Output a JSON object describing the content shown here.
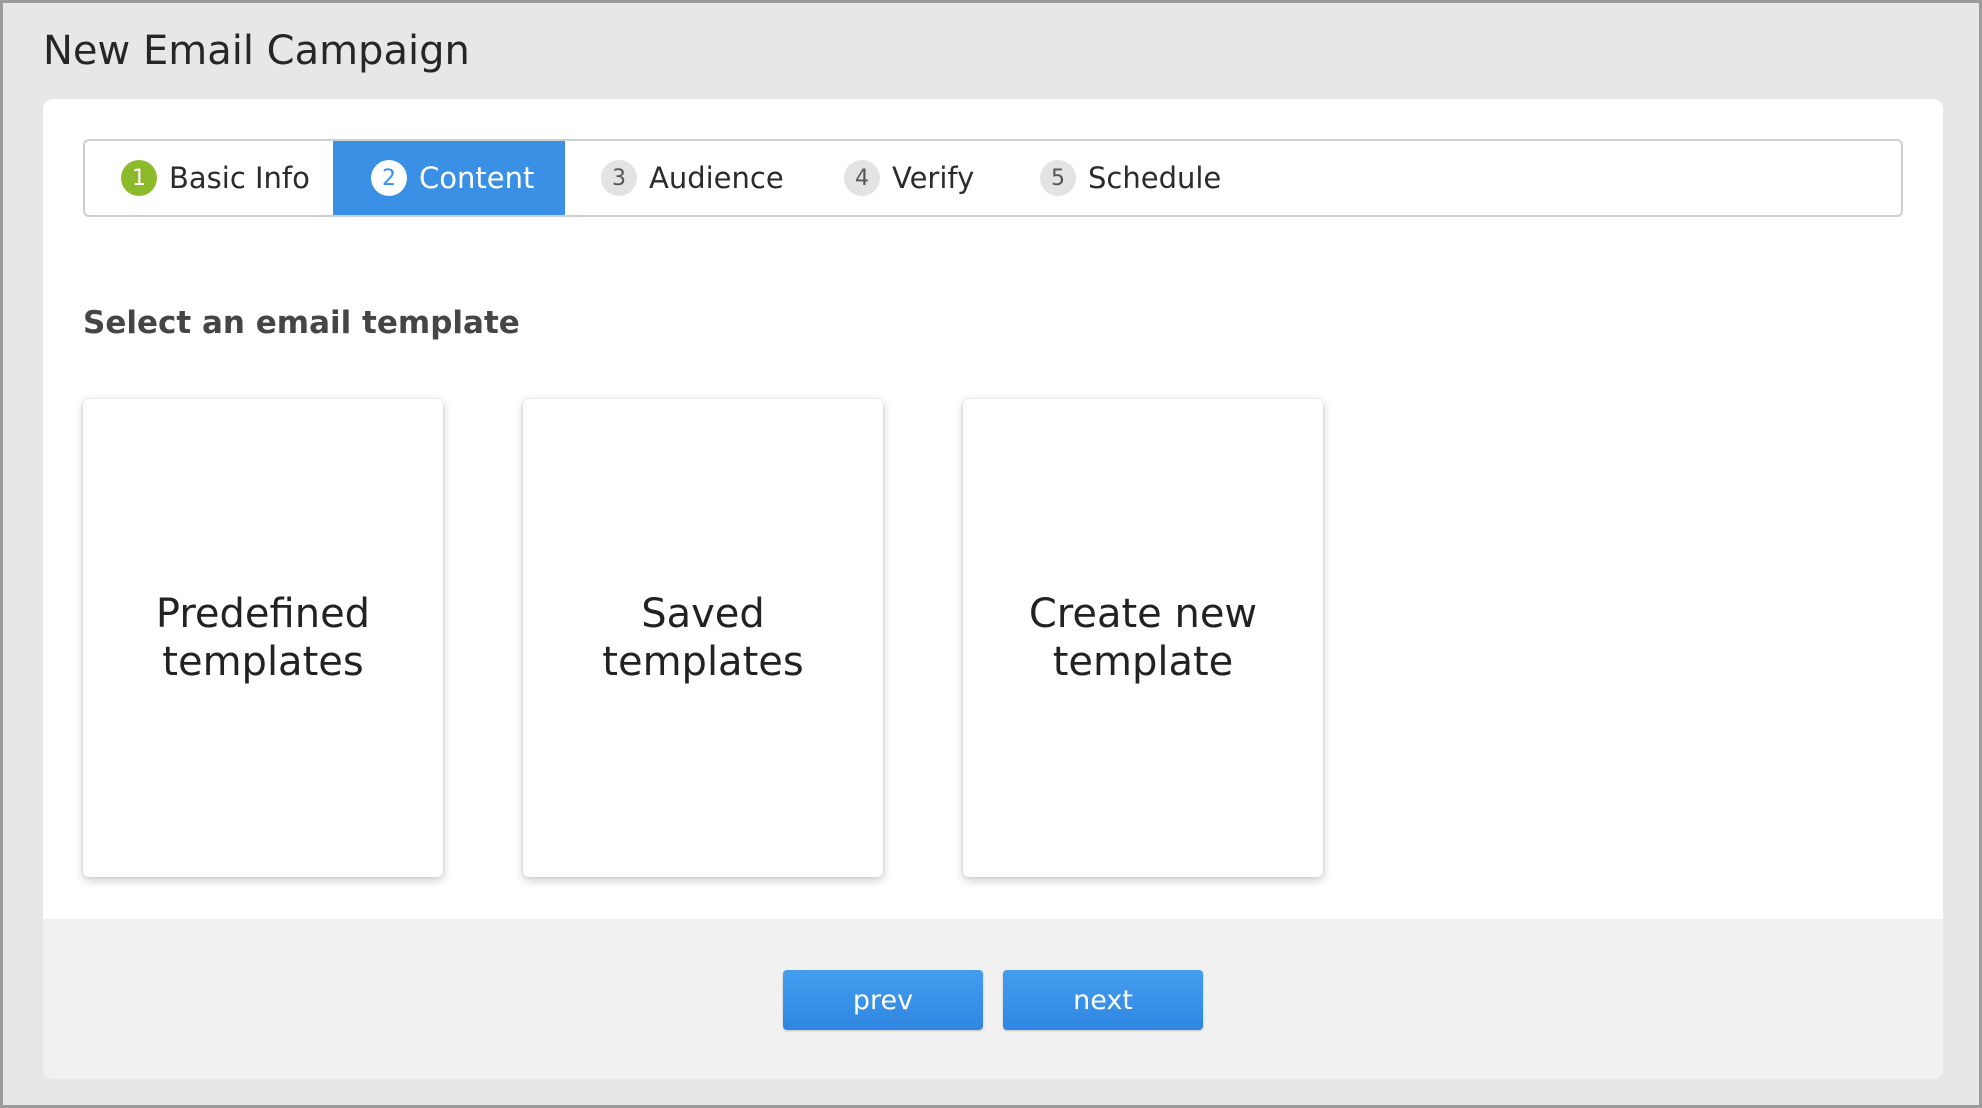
{
  "header": {
    "title": "New Email Campaign"
  },
  "steps": [
    {
      "number": "1",
      "label": "Basic Info",
      "state": "done"
    },
    {
      "number": "2",
      "label": "Content",
      "state": "active"
    },
    {
      "number": "3",
      "label": "Audience",
      "state": "pending"
    },
    {
      "number": "4",
      "label": "Verify",
      "state": "pending"
    },
    {
      "number": "5",
      "label": "Schedule",
      "state": "pending"
    }
  ],
  "content": {
    "heading": "Select an email template",
    "options": [
      {
        "label": "Predefined templates"
      },
      {
        "label": "Saved templates"
      },
      {
        "label": "Create new template"
      }
    ]
  },
  "footer": {
    "prev_label": "prev",
    "next_label": "next"
  },
  "colors": {
    "active_step": "#3990e4",
    "done_step": "#8dba2a",
    "button": "#3990e4"
  }
}
